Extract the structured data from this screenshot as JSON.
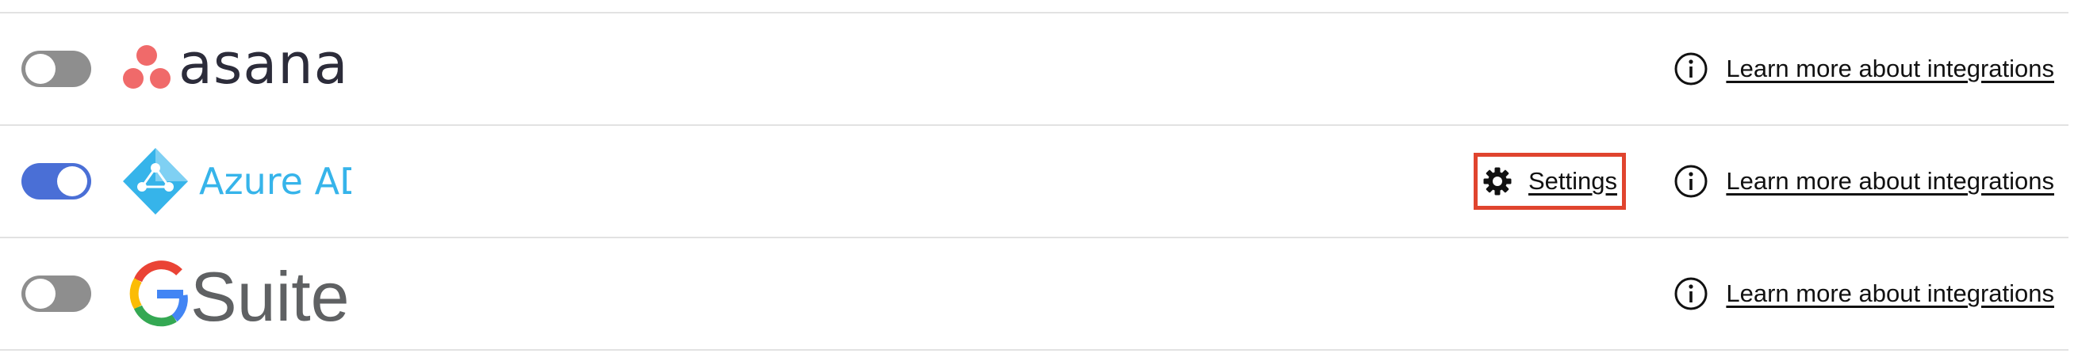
{
  "integrations": [
    {
      "id": "asana",
      "enabled": false,
      "logo_text": "asana",
      "learn_more_label": "Learn more about integrations",
      "has_settings": false
    },
    {
      "id": "azure-ad",
      "enabled": true,
      "logo_text": "Azure AD",
      "settings_label": "Settings",
      "learn_more_label": "Learn more about integrations",
      "has_settings": true
    },
    {
      "id": "gsuite",
      "enabled": false,
      "logo_text": "Suite",
      "learn_more_label": "Learn more about integrations",
      "has_settings": false
    }
  ],
  "colors": {
    "toggle_on": "#4a6fd6",
    "toggle_off": "#8e8e8e",
    "highlight_border": "#e0442e",
    "asana_coral": "#f06a6a",
    "azure_blue": "#36b4ea"
  },
  "icons": {
    "info": "info-circle-icon",
    "settings": "gear-icon"
  }
}
